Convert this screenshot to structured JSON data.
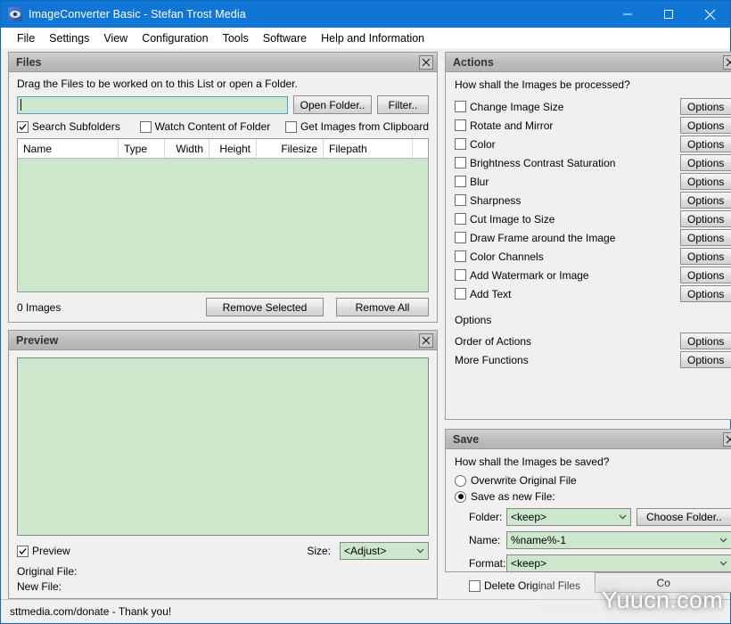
{
  "window": {
    "title": "ImageConverter Basic - Stefan Trost Media",
    "icon": "app-image-converter-icon",
    "minimize": "minimize-icon",
    "maximize": "maximize-icon",
    "close": "close-icon",
    "titlebar_color": "#0f76d6"
  },
  "menubar": {
    "items": [
      {
        "label": "File"
      },
      {
        "label": "Settings"
      },
      {
        "label": "View"
      },
      {
        "label": "Configuration"
      },
      {
        "label": "Tools"
      },
      {
        "label": "Software"
      },
      {
        "label": "Help and Information"
      }
    ]
  },
  "files_panel": {
    "title": "Files",
    "close_icon": "panel-close-icon",
    "hint": "Drag the Files to be worked on to this List or open a Folder.",
    "path_input": {
      "value": "",
      "placeholder": ""
    },
    "open_folder_button": "Open Folder..",
    "filter_button": "Filter..",
    "checkboxes": [
      {
        "label": "Search Subfolders",
        "checked": true
      },
      {
        "label": "Watch Content of Folder",
        "checked": false
      },
      {
        "label": "Get Images from Clipboard",
        "checked": false
      }
    ],
    "columns": [
      {
        "label": "Name",
        "align": "left",
        "width": 113
      },
      {
        "label": "Type",
        "align": "left",
        "width": 52
      },
      {
        "label": "Width",
        "align": "right",
        "width": 50
      },
      {
        "label": "Height",
        "align": "right",
        "width": 53
      },
      {
        "label": "Filesize",
        "align": "right",
        "width": 75
      },
      {
        "label": "Filepath",
        "align": "left",
        "width": 100
      },
      {
        "label": "",
        "align": "left",
        "width": 26
      }
    ],
    "rows": [],
    "count_label": "0 Images",
    "remove_selected_button": "Remove Selected",
    "remove_all_button": "Remove All"
  },
  "preview_panel": {
    "title": "Preview",
    "close_icon": "panel-close-icon",
    "preview_checkbox": {
      "label": "Preview",
      "checked": true
    },
    "size_label": "Size:",
    "size_value": "<Adjust>",
    "original_file_label": "Original File:",
    "new_file_label": "New File:"
  },
  "actions_panel": {
    "title": "Actions",
    "close_icon": "panel-close-icon",
    "hint": "How shall the Images be processed?",
    "options_button": "Options",
    "actions": [
      {
        "label": "Change Image Size",
        "checked": false
      },
      {
        "label": "Rotate and Mirror",
        "checked": false
      },
      {
        "label": "Color",
        "checked": false
      },
      {
        "label": "Brightness Contrast Saturation",
        "checked": false
      },
      {
        "label": "Blur",
        "checked": false
      },
      {
        "label": "Sharpness",
        "checked": false
      },
      {
        "label": "Cut Image to Size",
        "checked": false
      },
      {
        "label": "Draw Frame around the Image",
        "checked": false
      },
      {
        "label": "Color Channels",
        "checked": false
      },
      {
        "label": "Add Watermark or Image",
        "checked": false
      },
      {
        "label": "Add Text",
        "checked": false
      }
    ],
    "options_heading": "Options",
    "extra_rows": [
      {
        "label": "Order of Actions",
        "button": "Options"
      },
      {
        "label": "More Functions",
        "button": "Options"
      }
    ]
  },
  "save_panel": {
    "title": "Save",
    "close_icon": "panel-close-icon",
    "hint": "How shall the Images be saved?",
    "radios": [
      {
        "label": "Overwrite Original File",
        "selected": false
      },
      {
        "label": "Save as new File:",
        "selected": true
      }
    ],
    "folder_label": "Folder:",
    "folder_value": "<keep>",
    "choose_folder_button": "Choose Folder..",
    "name_label": "Name:",
    "name_value": "%name%-1",
    "format_label": "Format:",
    "format_value": "<keep>",
    "delete_original_checkbox": {
      "label": "Delete Original Files",
      "checked": false
    }
  },
  "bottom": {
    "convert_button": "Co",
    "watermark": "Yuucn.com"
  },
  "statusbar": {
    "text": "sttmedia.com/donate - Thank you!"
  },
  "colors": {
    "field_green": "#cde7cd",
    "panel_gray": "#f0f0f0",
    "title_blue": "#0f76d6"
  }
}
